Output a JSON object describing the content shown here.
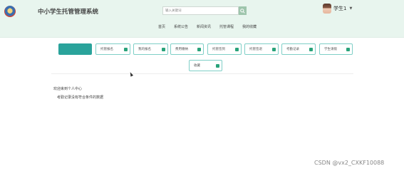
{
  "header": {
    "title": "中小学生托管管理系统",
    "search_placeholder": "输入关键词",
    "user_name": "学生1",
    "nav": [
      "首页",
      "系统公告",
      "新闻资讯",
      "托管课程",
      "我的收藏"
    ]
  },
  "tiles": [
    {
      "label": "",
      "active": true
    },
    {
      "label": "托管报名"
    },
    {
      "label": "我的报名"
    },
    {
      "label": "费用缴纳"
    },
    {
      "label": "托管签到"
    },
    {
      "label": "托管签退"
    },
    {
      "label": "考勤记录"
    },
    {
      "label": "学生请假"
    },
    {
      "label": "收藏"
    }
  ],
  "main": {
    "welcome": "欢迎来到个人中心",
    "notice": "考勤记录没有符合条件的数据"
  },
  "watermark": "CSDN @vx2_CXKF10088",
  "colors": {
    "accent": "#2aa39b",
    "tile_border": "#7fcfc7",
    "header_bg": "#e8f5ee"
  }
}
